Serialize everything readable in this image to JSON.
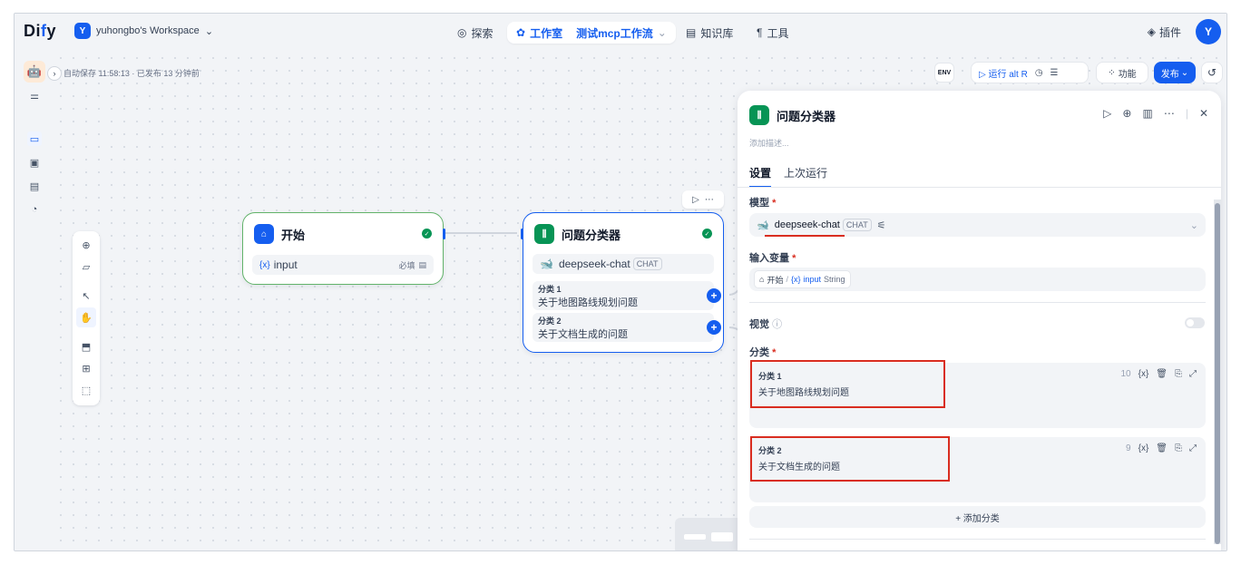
{
  "app": {
    "logo_prefix": "Di",
    "logo_accent": "f",
    "logo_suffix": "y"
  },
  "workspace": {
    "initial": "Y",
    "name": "yuhongbo's Workspace"
  },
  "nav": {
    "explore": "探索",
    "studio": "工作室",
    "current_app": "测试mcp工作流",
    "knowledge": "知识库",
    "tools": "工具"
  },
  "top_right": {
    "plugins": "插件",
    "user_initial": "Y"
  },
  "canvas": {
    "autosave": "自动保存 11:58:13 · 已发布 13 分钟前",
    "env_label": "ENV",
    "run_label": "运行 alt R",
    "features_label": "功能",
    "publish_label": "发布"
  },
  "start_node": {
    "title": "开始",
    "var_name": "input",
    "required_label": "必填"
  },
  "classifier_node": {
    "title": "问题分类器",
    "model": "deepseek-chat",
    "model_tag": "CHAT",
    "classes": [
      {
        "title": "分类 1",
        "desc": "关于地图路线规划问题"
      },
      {
        "title": "分类 2",
        "desc": "关于文档生成的问题"
      }
    ]
  },
  "panel": {
    "title": "问题分类器",
    "desc_placeholder": "添加描述...",
    "tabs": [
      "设置",
      "上次运行"
    ],
    "model_label": "模型",
    "model_name": "deepseek-chat",
    "model_tag": "CHAT",
    "input_var_label": "输入变量",
    "input_var_source": "开始",
    "input_var_name": "input",
    "input_var_type": "String",
    "vision_label": "视觉",
    "classes_label": "分类",
    "classes": [
      {
        "title": "分类 1",
        "desc": "关于地图路线规划问题",
        "count": "10"
      },
      {
        "title": "分类 2",
        "desc": "关于文档生成的问题",
        "count": "9"
      }
    ],
    "add_class_label": "+ 添加分类"
  },
  "colors": {
    "accent": "#155eef",
    "success": "#079455",
    "start_green": "#62b36a",
    "highlight": "#d92d20"
  }
}
